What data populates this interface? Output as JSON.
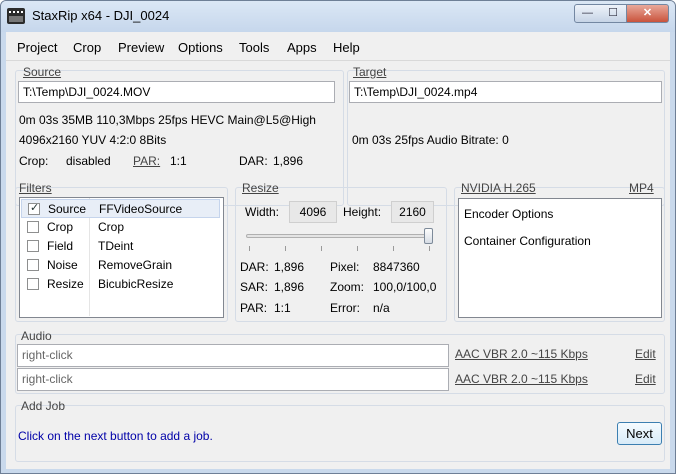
{
  "window": {
    "title": "StaxRip x64 - DJI_0024",
    "min_glyph": "—",
    "max_glyph": "☐",
    "close_glyph": "✕"
  },
  "menu": [
    "Project",
    "Crop",
    "Preview",
    "Options",
    "Tools",
    "Apps",
    "Help"
  ],
  "source": {
    "title": "Source",
    "path": "T:\\Temp\\DJI_0024.MOV",
    "info1": "0m 03s  35MB  110,3Mbps  25fps  HEVC  Main@L5@High",
    "info2": "4096x2160    YUV   4:2:0   8Bits",
    "crop_label": "Crop:",
    "crop_value": "disabled",
    "par_label": "PAR:",
    "par_value": "1:1",
    "dar_label": "DAR:",
    "dar_value": "1,896"
  },
  "target": {
    "title": "Target",
    "path": "T:\\Temp\\DJI_0024.mp4",
    "info": "0m 03s    25fps    Audio Bitrate: 0"
  },
  "filters": {
    "title": "Filters",
    "items": [
      {
        "name": "Source",
        "value": "FFVideoSource",
        "checked": true
      },
      {
        "name": "Crop",
        "value": "Crop",
        "checked": false
      },
      {
        "name": "Field",
        "value": "TDeint",
        "checked": false
      },
      {
        "name": "Noise",
        "value": "RemoveGrain",
        "checked": false
      },
      {
        "name": "Resize",
        "value": "BicubicResize",
        "checked": false
      }
    ]
  },
  "resize": {
    "title": "Resize",
    "width_label": "Width:",
    "width_value": "4096",
    "height_label": "Height:",
    "height_value": "2160",
    "slider_fraction": 1.0,
    "dar_label": "DAR:",
    "dar_value": "1,896",
    "pixel_label": "Pixel:",
    "pixel_value": "8847360",
    "sar_label": "SAR:",
    "sar_value": "1,896",
    "zoom_label": "Zoom:",
    "zoom_value": "100,0/100,0",
    "par_label": "PAR:",
    "par_value": "1:1",
    "error_label": "Error:",
    "error_value": "n/a"
  },
  "encoder": {
    "title": "NVIDIA H.265",
    "container": "MP4",
    "items": [
      "Encoder Options",
      "Container Configuration"
    ]
  },
  "audio": {
    "title": "Audio",
    "tracks": [
      {
        "field": "right-click",
        "profile": "AAC VBR 2.0 ~115 Kbps",
        "edit": "Edit"
      },
      {
        "field": "right-click",
        "profile": "AAC VBR 2.0 ~115 Kbps",
        "edit": "Edit"
      }
    ]
  },
  "addjob": {
    "title": "Add Job",
    "message": "Click on the next button to add a job.",
    "next_label": "Next"
  }
}
